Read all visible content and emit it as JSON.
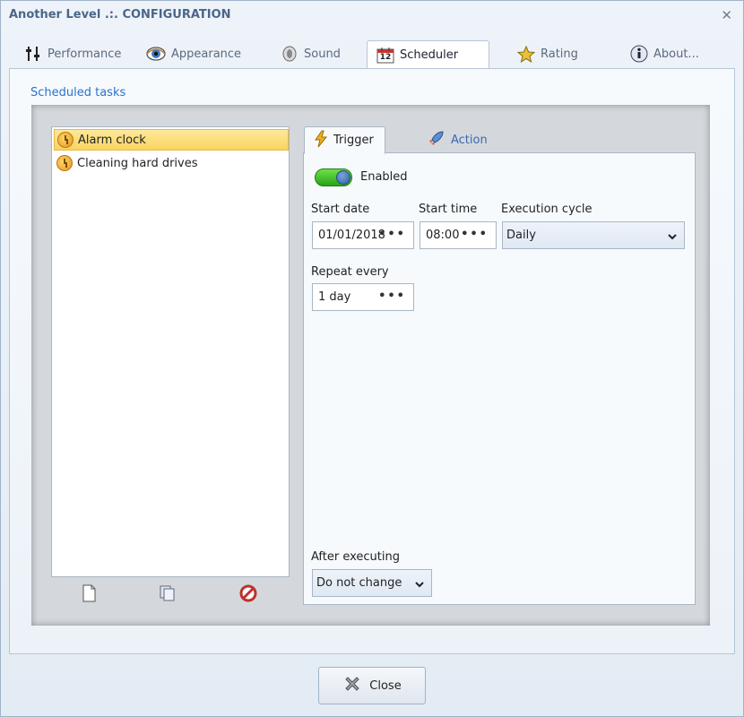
{
  "window": {
    "title": "Another Level  .:.  CONFIGURATION",
    "close_glyph": "✕"
  },
  "tabs": [
    {
      "label": "Performance",
      "icon": "sliders-icon"
    },
    {
      "label": "Appearance",
      "icon": "eye-icon"
    },
    {
      "label": "Sound",
      "icon": "speaker-icon"
    },
    {
      "label": "Scheduler",
      "icon": "calendar-icon",
      "calendar_day": "12",
      "active": true
    },
    {
      "label": "Rating",
      "icon": "star-icon"
    },
    {
      "label": "About...",
      "icon": "info-icon"
    }
  ],
  "section": {
    "label": "Scheduled tasks"
  },
  "tasks": [
    {
      "label": "Alarm clock",
      "selected": true
    },
    {
      "label": "Cleaning hard drives",
      "selected": false
    }
  ],
  "list_buttons": [
    {
      "icon": "new-document-icon"
    },
    {
      "icon": "copy-icon"
    },
    {
      "icon": "delete-icon"
    }
  ],
  "panel_tabs": [
    {
      "label": "Trigger",
      "icon": "lightning-icon",
      "active": true
    },
    {
      "label": "Action",
      "icon": "rocket-icon",
      "active": false
    }
  ],
  "trigger": {
    "enabled_label": "Enabled",
    "enabled": true,
    "start_date_label": "Start date",
    "start_date_value": "01/01/2018",
    "start_time_label": "Start time",
    "start_time_value": "08:00",
    "execution_cycle_label": "Execution cycle",
    "execution_cycle_value": "Daily",
    "repeat_every_label": "Repeat every",
    "repeat_every_value": "1 day",
    "after_executing_label": "After executing",
    "after_executing_value": "Do not change",
    "ellipsis": "•••"
  },
  "footer": {
    "close_label": "Close"
  },
  "colors": {
    "accent": "#2a73c7",
    "selection": "#f9d460",
    "toggle_on": "#28a418"
  }
}
